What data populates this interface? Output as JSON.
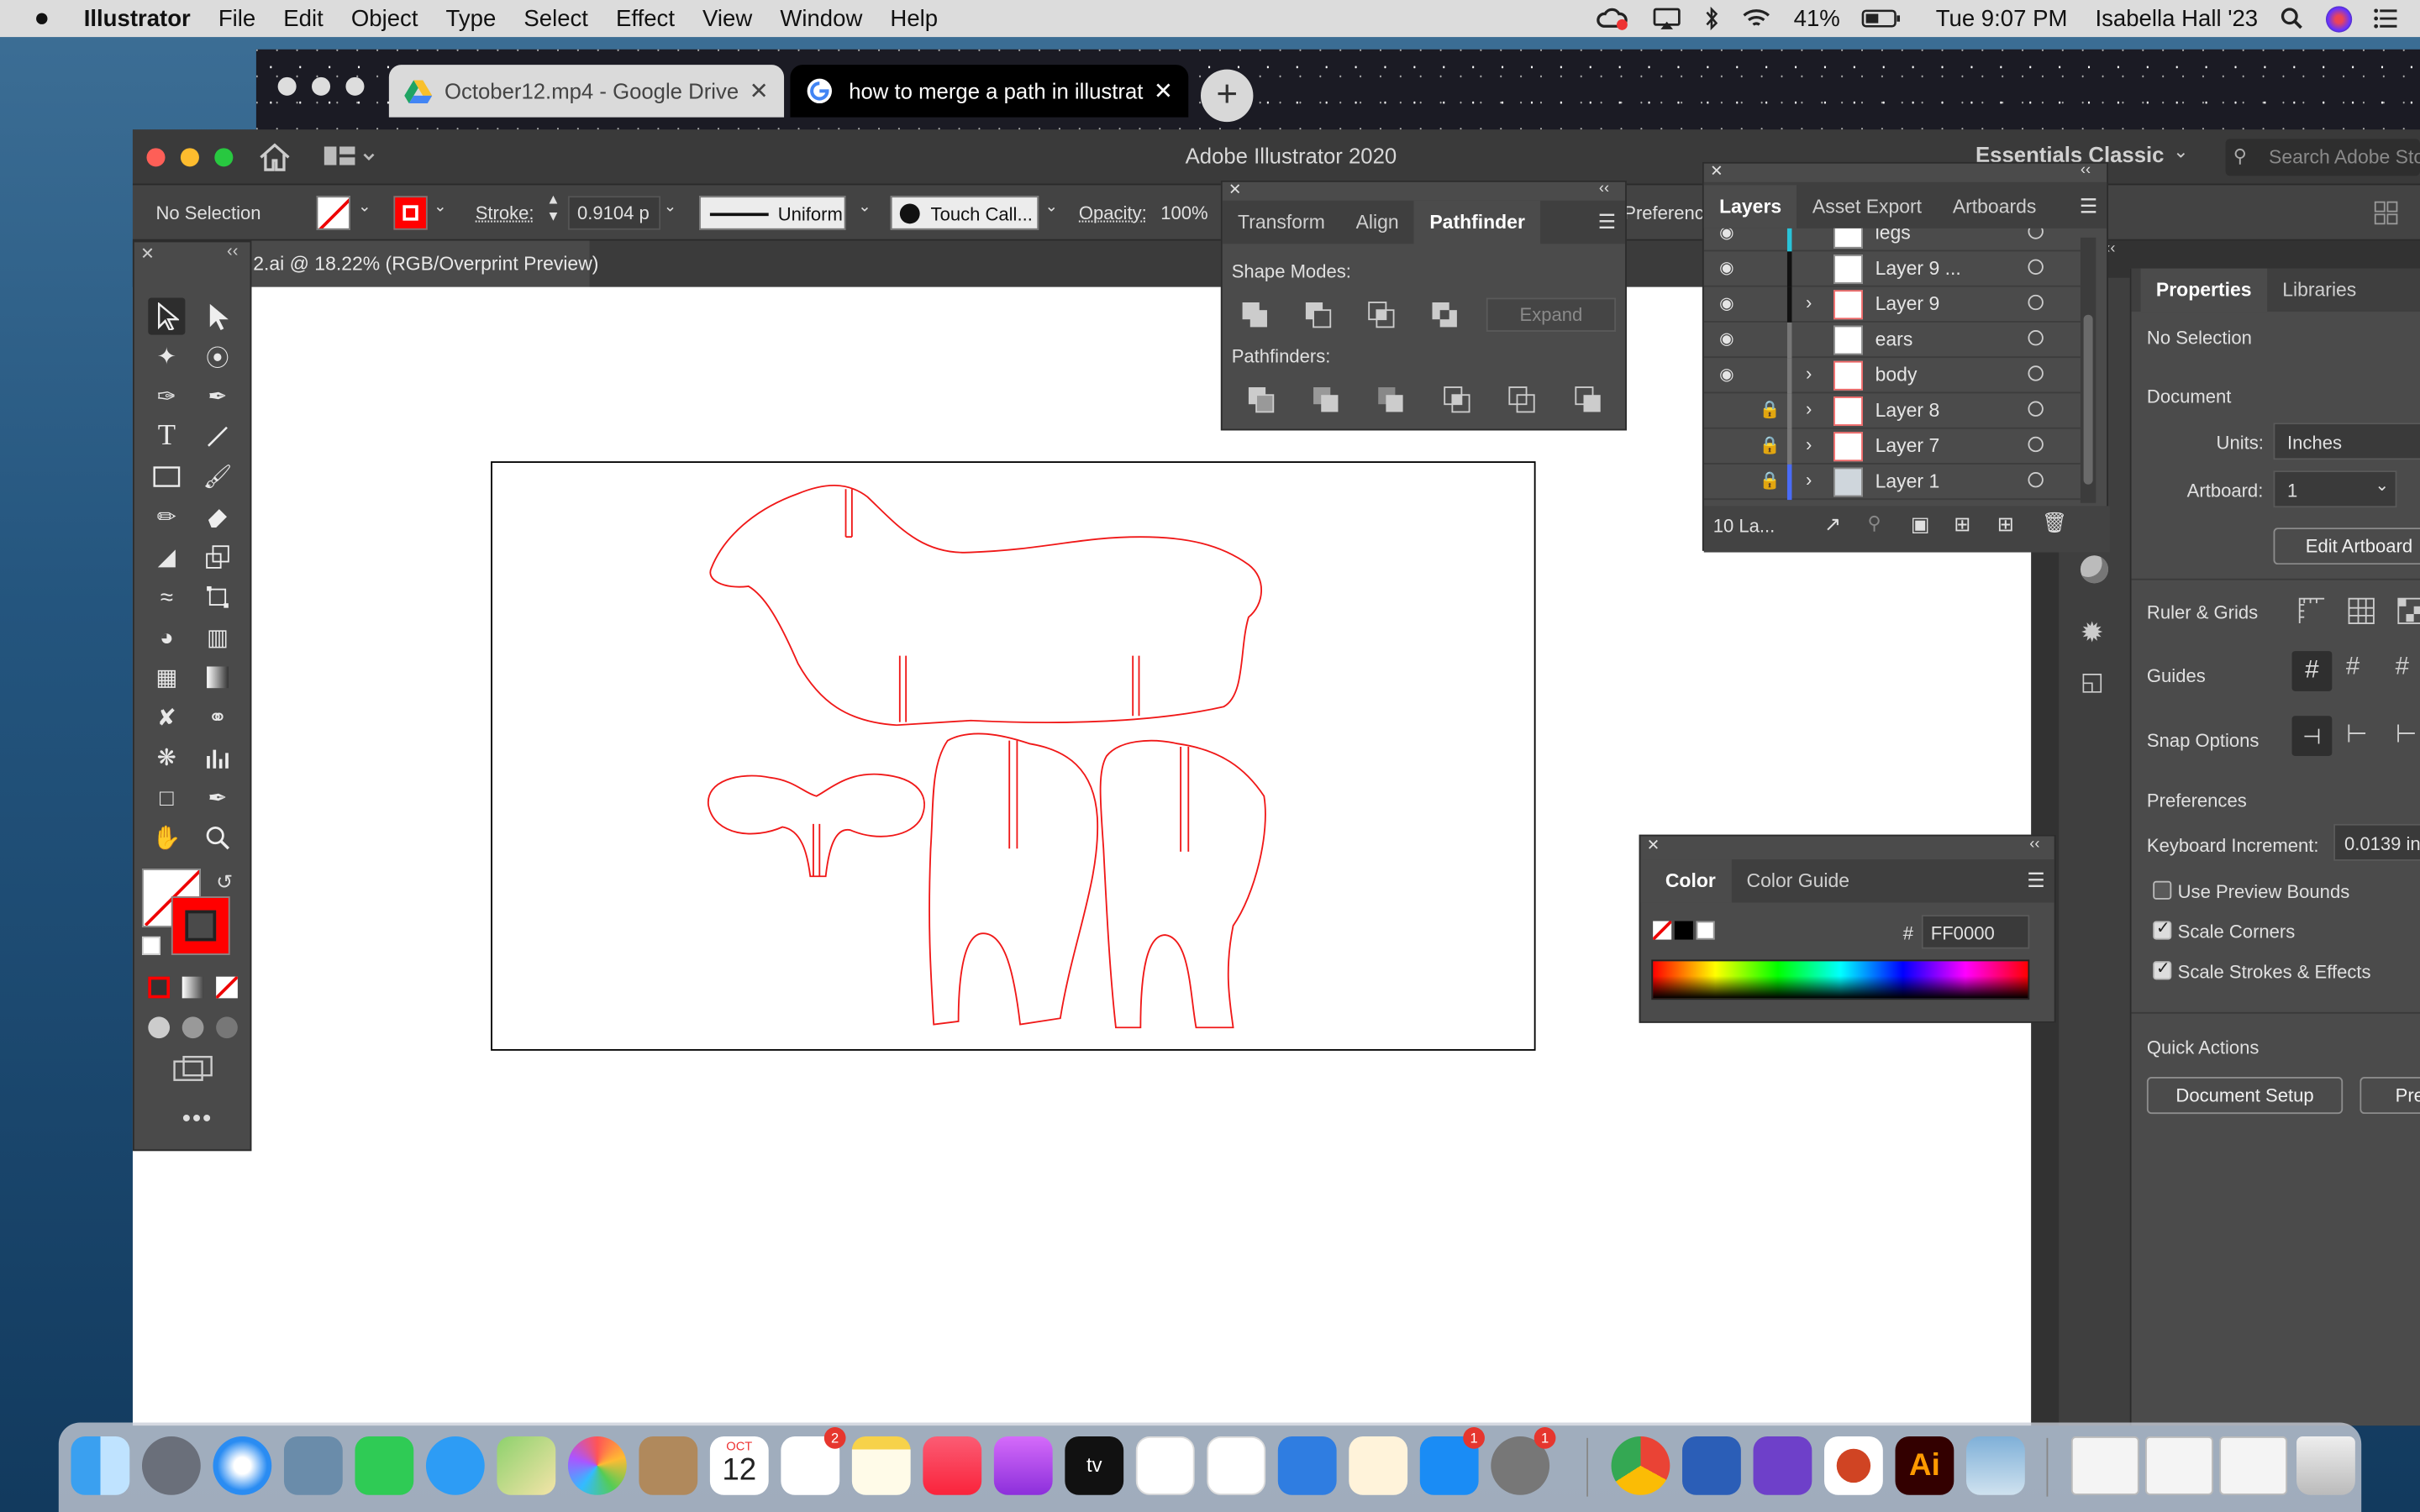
{
  "menubar": {
    "app_name": "Illustrator",
    "menus": [
      "File",
      "Edit",
      "Object",
      "Type",
      "Select",
      "Effect",
      "View",
      "Window",
      "Help"
    ],
    "battery": "41%",
    "clock": "Tue 9:07 PM",
    "user": "Isabella Hall '23"
  },
  "browser": {
    "tabs": [
      {
        "title": "October12.mp4 - Google Drive",
        "icon": "google-drive-icon"
      },
      {
        "title": "how to merge a path in illustrat",
        "icon": "google-icon"
      }
    ]
  },
  "app": {
    "window_title": "Adobe Illustrator 2020",
    "workspace": "Essentials Classic",
    "search_placeholder": "Search Adobe Sto",
    "document_tab": "2.ai @ 18.22% (RGB/Overprint Preview)"
  },
  "control_bar": {
    "selection": "No Selection",
    "stroke_label": "Stroke:",
    "stroke_value": "0.9104 p",
    "profile": "Uniform",
    "brush": "Touch Call...",
    "opacity_label": "Opacity:",
    "opacity_value": "100%",
    "preferences": "Preferenc"
  },
  "pathfinder_panel": {
    "tabs": [
      "Transform",
      "Align",
      "Pathfinder"
    ],
    "active_tab": "Pathfinder",
    "shape_modes_label": "Shape Modes:",
    "expand_label": "Expand",
    "pathfinders_label": "Pathfinders:"
  },
  "layers_panel": {
    "tabs": [
      "Layers",
      "Asset Export",
      "Artboards"
    ],
    "layers": [
      {
        "name": "legs",
        "visible": true,
        "locked": false,
        "expandable": false
      },
      {
        "name": "Layer 9 ...",
        "visible": true,
        "locked": false,
        "expandable": false
      },
      {
        "name": "Layer 9",
        "visible": true,
        "locked": false,
        "expandable": true
      },
      {
        "name": "ears",
        "visible": true,
        "locked": false,
        "expandable": false
      },
      {
        "name": "body",
        "visible": true,
        "locked": false,
        "expandable": true
      },
      {
        "name": "Layer 8",
        "visible": false,
        "locked": true,
        "expandable": true
      },
      {
        "name": "Layer 7",
        "visible": false,
        "locked": true,
        "expandable": true
      },
      {
        "name": "Layer 1",
        "visible": false,
        "locked": true,
        "expandable": true
      }
    ],
    "footer_count": "10 La..."
  },
  "color_panel": {
    "tabs": [
      "Color",
      "Color Guide"
    ],
    "hex_label": "#",
    "hex_value": "FF0000"
  },
  "properties_panel": {
    "tabs": [
      "Properties",
      "Libraries"
    ],
    "selection": "No Selection",
    "document_heading": "Document",
    "units_label": "Units:",
    "units_value": "Inches",
    "artboard_label": "Artboard:",
    "artboard_value": "1",
    "edit_artboards": "Edit Artboard",
    "ruler_grids": "Ruler & Grids",
    "guides": "Guides",
    "snap_options": "Snap Options",
    "preferences_heading": "Preferences",
    "keyboard_increment_label": "Keyboard Increment:",
    "keyboard_increment_value": "0.0139 in",
    "use_preview_bounds": "Use Preview Bounds",
    "scale_corners": "Scale Corners",
    "scale_strokes": "Scale Strokes & Effects",
    "checkbox_states": {
      "use_preview_bounds": false,
      "scale_corners": true,
      "scale_strokes": true
    },
    "quick_actions": "Quick Actions",
    "document_setup": "Document Setup",
    "pre_button": "Pre"
  },
  "colors": {
    "stroke_red": "#ff0000",
    "ui_dark": "#4b4b4b",
    "ui_darker": "#323232",
    "selection_blue": "#2f8ef7"
  },
  "dock": {
    "calendar_month": "OCT",
    "calendar_day": "12",
    "reminders_badge": "2",
    "appstore_badge": "1",
    "settings_badge": "1",
    "appletv_label": "tv",
    "illustrator_label": "Ai"
  }
}
